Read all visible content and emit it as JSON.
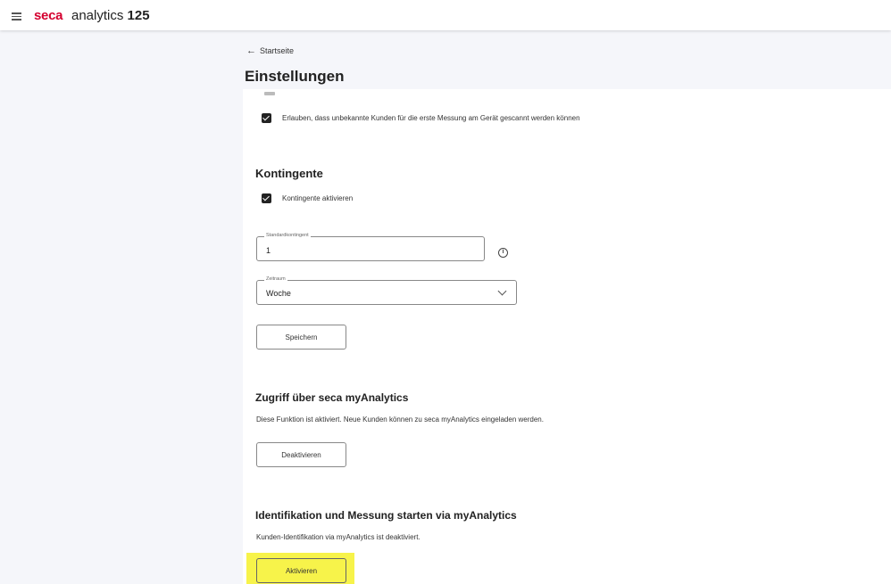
{
  "header": {
    "brand": "seca",
    "product": "analytics",
    "product_number": "125",
    "menu_icon": "hamburger-menu-icon"
  },
  "nav": {
    "back_label": "Startseite",
    "back_icon": "arrow-left-icon"
  },
  "page": {
    "title": "Einstellungen"
  },
  "scan_section": {
    "allow_unknown_label": "Erlauben, dass unbekannte Kunden für die erste Messung am Gerät gescannt werden können",
    "allow_unknown_checked": true
  },
  "kontingente": {
    "title": "Kontingente",
    "activate_label": "Kontingente aktivieren",
    "activate_checked": true,
    "standard_field_label": "Standardkontingent",
    "standard_field_value": "1",
    "info_icon": "info-icon",
    "period_field_label": "Zeitraum",
    "period_field_value": "Woche",
    "save_label": "Speichern"
  },
  "myanalytics_access": {
    "title": "Zugriff über seca myAnalytics",
    "description": "Diese Funktion ist aktiviert. Neue Kunden können zu seca myAnalytics eingeladen werden.",
    "button_label": "Deaktivieren"
  },
  "identification": {
    "title": "Identifikation und Messung starten via myAnalytics",
    "description": "Kunden-Identifikation via myAnalytics ist deaktiviert.",
    "button_label": "Aktivieren"
  },
  "colors": {
    "brand_red": "#d4002f",
    "highlight_yellow": "#f7f34a",
    "page_background": "#f5f6fa"
  }
}
